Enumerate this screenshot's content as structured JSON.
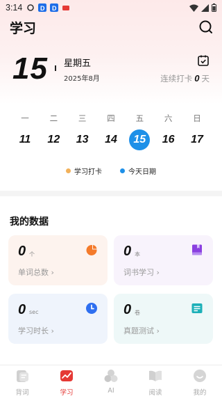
{
  "status_bar": {
    "time": "3:14"
  },
  "header": {
    "title": "学习"
  },
  "date": {
    "day": "15",
    "weekday": "星期五",
    "year_month": "2025年8月",
    "streak_label": "连续打卡",
    "streak_days": "0",
    "streak_unit": "天"
  },
  "week": {
    "labels": [
      "一",
      "二",
      "三",
      "四",
      "五",
      "六",
      "日"
    ],
    "days": [
      "11",
      "12",
      "13",
      "14",
      "15",
      "16",
      "17"
    ],
    "active_index": 4
  },
  "legend": [
    {
      "label": "学习打卡",
      "color": "#f2b15a"
    },
    {
      "label": "今天日期",
      "color": "#1e90e8"
    }
  ],
  "stats": {
    "title": "我的数据",
    "cards": [
      {
        "value": "0",
        "unit": "个",
        "label": "单词总数 ›",
        "icon": "pie-chart-icon",
        "color": "#f47a2a"
      },
      {
        "value": "0",
        "unit": "本",
        "label": "词书学习 ›",
        "icon": "book-icon",
        "color": "#8a3fe0"
      },
      {
        "value": "0",
        "unit": "sec",
        "label": "学习时长 ›",
        "icon": "clock-icon",
        "color": "#2f6ff0"
      },
      {
        "value": "0",
        "unit": "卷",
        "label": "真题测试 ›",
        "icon": "exam-icon",
        "color": "#1db0b8"
      }
    ]
  },
  "tabs": [
    {
      "label": "背词",
      "icon": "flashcard-icon"
    },
    {
      "label": "学习",
      "icon": "chart-icon"
    },
    {
      "label": "AI",
      "icon": "ai-icon"
    },
    {
      "label": "阅读",
      "icon": "reading-icon"
    },
    {
      "label": "我的",
      "icon": "profile-icon"
    }
  ],
  "active_tab": 1
}
